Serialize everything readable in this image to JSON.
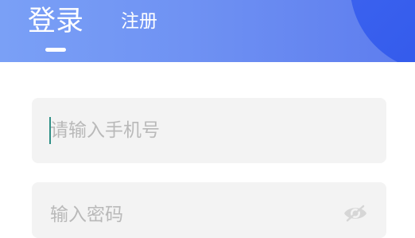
{
  "header": {
    "tabs": [
      {
        "label": "登录",
        "active": true
      },
      {
        "label": "注册",
        "active": false
      }
    ],
    "gradient_start": "#7aa0f6",
    "gradient_end": "#5d7cee",
    "accent_circle": "#3f66f0"
  },
  "form": {
    "phone": {
      "placeholder": "请输入手机号",
      "value": ""
    },
    "password": {
      "placeholder": "输入密码",
      "value": "",
      "toggle_icon": "eye-icon"
    }
  }
}
